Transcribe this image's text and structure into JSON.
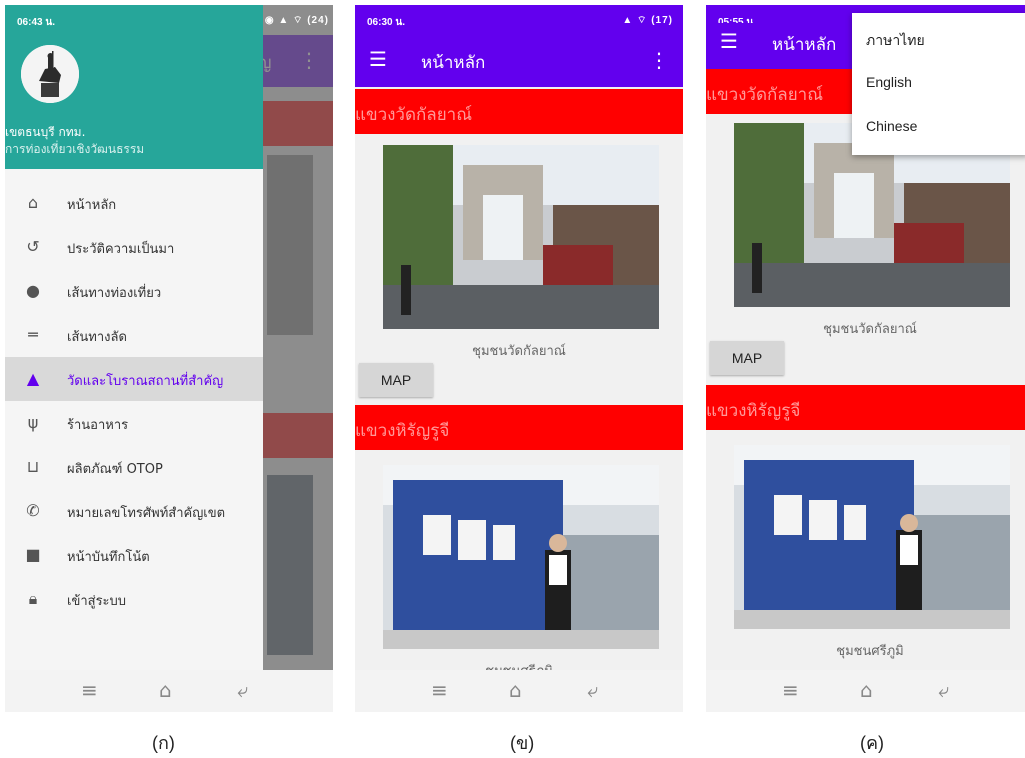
{
  "panel1": {
    "status_time": "06:43 น.",
    "status_icons": "◉ ▲ ⌔ (24)",
    "appbar_partial_title": "ัญ",
    "drawer": {
      "name": "เขตธนบุรี กทม.",
      "subtitle": "การท่องเที่ยวเชิงวัฒนธรรม",
      "items": [
        {
          "label": "หน้าหลัก",
          "icon": "home-icon"
        },
        {
          "label": "ประวัติความเป็นมา",
          "icon": "history-icon"
        },
        {
          "label": "เส้นทางท่องเที่ยว",
          "icon": "location-pin-icon"
        },
        {
          "label": "เส้นทางลัด",
          "icon": "shortcut-icon"
        },
        {
          "label": "วัดและโบราณสถานที่สำคัญ",
          "icon": "temple-icon"
        },
        {
          "label": "ร้านอาหาร",
          "icon": "restaurant-icon"
        },
        {
          "label": "ผลิตภัณฑ์ OTOP",
          "icon": "basket-icon"
        },
        {
          "label": "หมายเลขโทรศัพท์สำคัญเขต",
          "icon": "phone-icon"
        },
        {
          "label": "หน้าบันทึกโน้ต",
          "icon": "note-icon"
        },
        {
          "label": "เข้าสู่ระบบ",
          "icon": "lock-icon"
        }
      ]
    }
  },
  "panel2": {
    "status_time": "06:30 น.",
    "status_icons": "▲ ⌔ (17)",
    "title": "หน้าหลัก",
    "section1": "แขวงวัดกัลยาณ์",
    "caption1": "ชุมชนวัดกัลยาณ์",
    "map_label": "MAP",
    "section2": "แขวงหิรัญรูจี",
    "caption2": "ชุมชนศรีภูมิ"
  },
  "panel3": {
    "status_time": "05:55 น.",
    "title": "หน้าหลัก",
    "section1": "แขวงวัดกัลยาณ์",
    "caption1": "ชุมชนวัดกัลยาณ์",
    "map_label": "MAP",
    "section2": "แขวงหิรัญรูจี",
    "caption2": "ชุมชนศรีภูมิ",
    "menu_options": [
      "ภาษาไทย",
      "English",
      "Chinese"
    ]
  },
  "labels": [
    "(ก)",
    "(ข)",
    "(ค)"
  ],
  "colors": {
    "appbar": "#6200ee",
    "section": "#ff0000",
    "drawer_header": "#26a69a",
    "active": "#6200ee"
  }
}
